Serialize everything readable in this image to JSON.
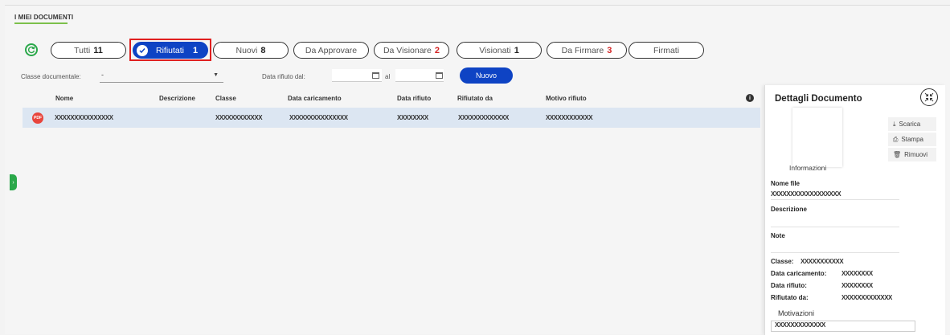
{
  "page": {
    "section_title": "I MIEI DOCUMENTI"
  },
  "tabs": [
    {
      "label": "Tutti",
      "count": "11",
      "count_red": false
    },
    {
      "label": "Rifiutati",
      "count": "1",
      "count_red": false,
      "active": true
    },
    {
      "label": "Nuovi",
      "count": "8",
      "count_red": false
    },
    {
      "label": "Da Approvare",
      "count": "",
      "count_red": false
    },
    {
      "label": "Da Visionare",
      "count": "2",
      "count_red": true
    },
    {
      "label": "Visionati",
      "count": "1",
      "count_red": false
    },
    {
      "label": "Da Firmare",
      "count": "3",
      "count_red": true
    },
    {
      "label": "Firmati",
      "count": "",
      "count_red": false
    }
  ],
  "filters": {
    "classe_label": "Classe documentale:",
    "classe_value": "-",
    "data_label": "Data rifiuto dal:",
    "al_label": "al",
    "nuovo_button": "Nuovo"
  },
  "table": {
    "columns": [
      "Nome",
      "Descrizione",
      "Classe",
      "Data caricamento",
      "Data rifiuto",
      "Rifiutato da",
      "Motivo rifiuto"
    ],
    "rows": [
      {
        "icon": "PDF",
        "nome": "XXXXXXXXXXXXXXX",
        "descrizione": "",
        "classe": "XXXXXXXXXXXX",
        "data_caricamento": "XXXXXXXXXXXXXXX",
        "data_rifiuto": "XXXXXXXX",
        "rifiutato_da": "XXXXXXXXXXXXX",
        "motivo": "XXXXXXXXXXXX"
      }
    ]
  },
  "panel": {
    "title": "Dettagli Documento",
    "info_tab": "Informazioni",
    "actions": [
      "Scarica",
      "Stampa",
      "Rimuovi"
    ],
    "nome_file_label": "Nome file",
    "nome_file_value": "XXXXXXXXXXXXXXXXXX",
    "descrizione_label": "Descrizione",
    "note_label": "Note",
    "classe_label": "Classe:",
    "classe_value": "XXXXXXXXXXX",
    "data_caricamento_label": "Data caricamento:",
    "data_caricamento_value": "XXXXXXXX",
    "data_rifiuto_label": "Data rifiuto:",
    "data_rifiuto_value": "XXXXXXXX",
    "rifiutato_da_label": "Rifiutato da:",
    "rifiutato_da_value": "XXXXXXXXXXXXX",
    "motivazioni_label": "Motivazioni",
    "motivazioni_value": "XXXXXXXXXXXXX"
  },
  "colors": {
    "primary": "#0e43c4",
    "green": "#2aa84a",
    "red": "#d32424",
    "row_selected": "#dce6f2"
  }
}
